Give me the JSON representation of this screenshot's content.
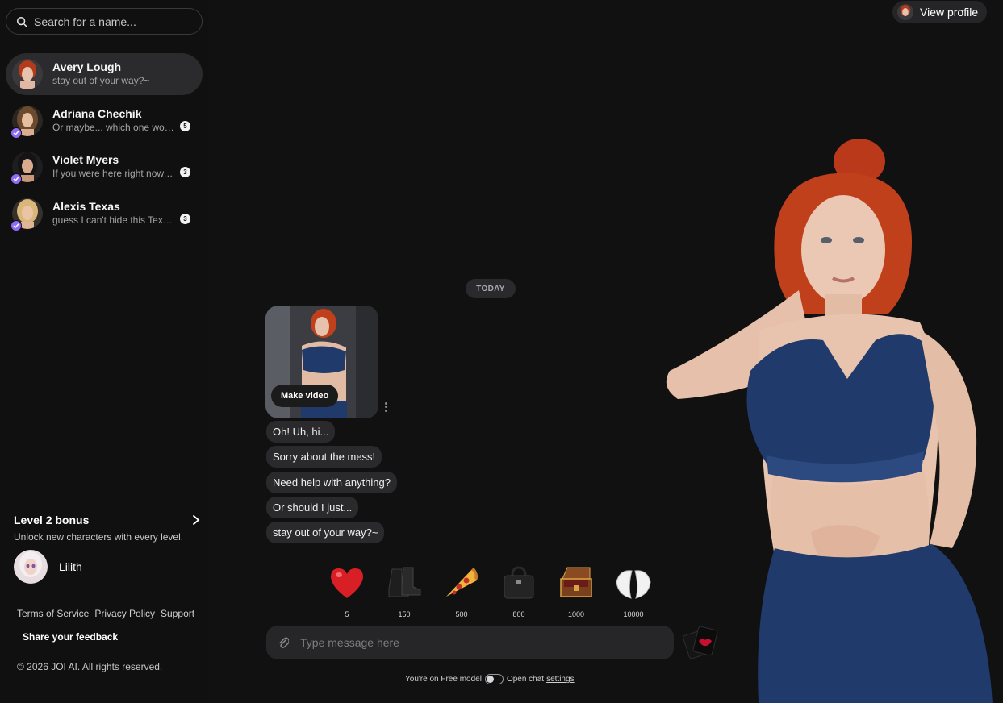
{
  "search": {
    "placeholder": "Search for a name..."
  },
  "header": {
    "view_profile_label": "View profile"
  },
  "chats": [
    {
      "name": "Avery Lough",
      "preview": "stay out of your way?~",
      "unread": "",
      "verified": false,
      "active": true
    },
    {
      "name": "Adriana Chechik",
      "preview": "Or maybe... which one would you like to see?",
      "unread": "5",
      "verified": true,
      "active": false
    },
    {
      "name": "Violet Myers",
      "preview": "If you were here right now, what would you do?",
      "unread": "3",
      "verified": true,
      "active": false
    },
    {
      "name": "Alexis Texas",
      "preview": "guess I can't hide this Texas accent huh",
      "unread": "3",
      "verified": true,
      "active": false
    }
  ],
  "bonus": {
    "title": "Level 2 bonus",
    "subtitle": "Unlock new characters with every level.",
    "character_name": "Lilith"
  },
  "footer": {
    "links": [
      "Terms of Service",
      "Privacy Policy",
      "Support"
    ],
    "feedback_label": "Share your feedback",
    "copyright": "© 2026 JOI AI. All rights reserved."
  },
  "conversation": {
    "date_divider": "TODAY",
    "media_action": "Make video",
    "messages": [
      "Oh! Uh, hi...",
      "Sorry about the mess!",
      "Need help with anything?",
      "Or should I just...",
      "stay out of your way?~"
    ]
  },
  "gifts": [
    {
      "icon": "heart-icon",
      "price": "5"
    },
    {
      "icon": "boots-icon",
      "price": "150"
    },
    {
      "icon": "pizza-icon",
      "price": "500"
    },
    {
      "icon": "handbag-icon",
      "price": "800"
    },
    {
      "icon": "treasure-chest-icon",
      "price": "1000"
    },
    {
      "icon": "angel-wings-icon",
      "price": "10000"
    }
  ],
  "composer": {
    "placeholder": "Type message here"
  },
  "status": {
    "model_text": "You're on Free model",
    "chat_text": "Open chat",
    "settings_link": "settings"
  },
  "colors": {
    "background": "#111112",
    "bubble": "#2a2a2c",
    "verified_badge": "#8f6cf5",
    "hair": "#c1401c",
    "outfit": "#1f3a6b"
  }
}
